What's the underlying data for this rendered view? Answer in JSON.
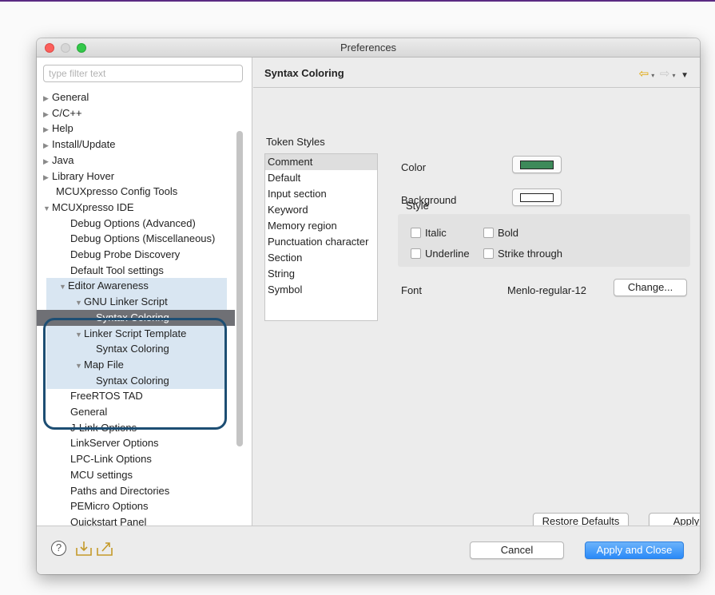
{
  "window": {
    "title": "Preferences"
  },
  "filter": {
    "placeholder": "type filter text"
  },
  "tree": [
    {
      "label": "General",
      "arrow": "▶"
    },
    {
      "label": "C/C++",
      "arrow": "▶"
    },
    {
      "label": "Help",
      "arrow": "▶"
    },
    {
      "label": "Install/Update",
      "arrow": "▶"
    },
    {
      "label": "Java",
      "arrow": "▶"
    },
    {
      "label": "Library Hover",
      "arrow": "▶"
    },
    {
      "label": "MCUXpresso Config Tools",
      "arrow": ""
    },
    {
      "label": "MCUXpresso IDE",
      "arrow": "▼"
    },
    {
      "label": "Debug Options (Advanced)",
      "arrow": ""
    },
    {
      "label": "Debug Options (Miscellaneous)",
      "arrow": ""
    },
    {
      "label": "Debug Probe Discovery",
      "arrow": ""
    },
    {
      "label": "Default Tool settings",
      "arrow": ""
    },
    {
      "label": "Editor Awareness",
      "arrow": "▼"
    },
    {
      "label": "GNU Linker Script",
      "arrow": "▼"
    },
    {
      "label": "Syntax Coloring",
      "arrow": ""
    },
    {
      "label": "Linker Script Template",
      "arrow": "▼"
    },
    {
      "label": "Syntax Coloring",
      "arrow": ""
    },
    {
      "label": "Map File",
      "arrow": "▼"
    },
    {
      "label": "Syntax Coloring",
      "arrow": ""
    },
    {
      "label": "FreeRTOS TAD",
      "arrow": ""
    },
    {
      "label": "General",
      "arrow": ""
    },
    {
      "label": "J-Link Options",
      "arrow": ""
    },
    {
      "label": "LinkServer Options",
      "arrow": ""
    },
    {
      "label": "LPC-Link Options",
      "arrow": ""
    },
    {
      "label": "MCU settings",
      "arrow": ""
    },
    {
      "label": "Paths and Directories",
      "arrow": ""
    },
    {
      "label": "PEMicro Options",
      "arrow": ""
    },
    {
      "label": "Quickstart Panel",
      "arrow": ""
    }
  ],
  "page": {
    "title": "Syntax Coloring"
  },
  "token_styles": {
    "label": "Token Styles",
    "items": [
      "Comment",
      "Default",
      "Input section",
      "Keyword",
      "Memory region",
      "Punctuation character",
      "Section",
      "String",
      "Symbol"
    ],
    "selected": "Comment"
  },
  "color": {
    "label": "Color",
    "value": "#3d8a5a"
  },
  "background": {
    "label": "Background",
    "value": "#ffffff"
  },
  "style": {
    "legend": "Style",
    "italic": "Italic",
    "bold": "Bold",
    "underline": "Underline",
    "strike": "Strike through"
  },
  "font": {
    "label": "Font",
    "value": "Menlo-regular-12",
    "change_button": "Change..."
  },
  "buttons": {
    "restore_defaults": "Restore Defaults",
    "apply": "Apply",
    "cancel": "Cancel",
    "apply_and_close": "Apply and Close"
  },
  "colors": {
    "accent": "#2a8af8",
    "selection": "#6f7075",
    "callout": "#1d4e73",
    "highlight": "#d9e6f2"
  }
}
